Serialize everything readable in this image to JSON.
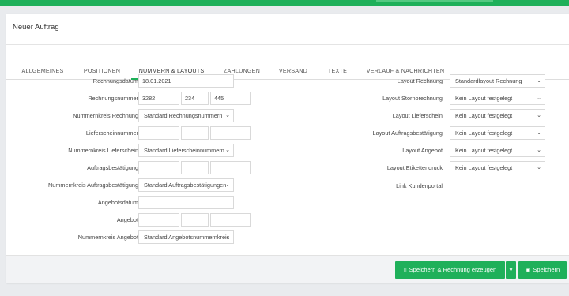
{
  "panel": {
    "title": "Neuer Auftrag"
  },
  "tabs": [
    {
      "label": "ALLGEMEINES"
    },
    {
      "label": "POSITIONEN"
    },
    {
      "label": "NUMMERN & LAYOUTS"
    },
    {
      "label": "ZAHLUNGEN"
    },
    {
      "label": "VERSAND"
    },
    {
      "label": "TEXTE"
    },
    {
      "label": "VERLAUF & NACHRICHTEN"
    }
  ],
  "left": {
    "rechnungsdatum": {
      "label": "Rechnungsdatum",
      "value": "18.01.2021"
    },
    "rechnungsnummer": {
      "label": "Rechnungsnummer",
      "v1": "3282",
      "v2": "234",
      "v3": "445"
    },
    "nk_rechnung": {
      "label": "Nummernkreis Rechnung",
      "value": "Standard Rechnungsnummern"
    },
    "lieferscheinnummer": {
      "label": "Lieferscheinnummer"
    },
    "nk_lieferschein": {
      "label": "Nummernkreis Lieferschein",
      "value": "Standard Lieferscheinnummern"
    },
    "auftragsbestaetigung": {
      "label": "Auftragsbestätigung"
    },
    "nk_auftrag": {
      "label": "Nummernkreis Auftragsbestätigung",
      "value": "Standard Auftragsbestätigungen"
    },
    "angebotsdatum": {
      "label": "Angebotsdatum"
    },
    "angebot": {
      "label": "Angebot"
    },
    "nk_angebot": {
      "label": "Nummernkreis Angebot",
      "value": "Standard Angebotsnummernkreis"
    }
  },
  "right": {
    "layout_rechnung": {
      "label": "Layout Rechnung",
      "value": "Standardlayout Rechnung"
    },
    "layout_storno": {
      "label": "Layout Stornorechnung",
      "value": "Kein Layout festgelegt"
    },
    "layout_lieferschein": {
      "label": "Layout Lieferschein",
      "value": "Kein Layout festgelegt"
    },
    "layout_auftrag": {
      "label": "Layout Auftragsbestätigung",
      "value": "Kein Layout festgelegt"
    },
    "layout_angebot": {
      "label": "Layout Angebot",
      "value": "Kein Layout festgelegt"
    },
    "layout_etikett": {
      "label": "Layout Etikettendruck",
      "value": "Kein Layout festgelegt"
    },
    "link_kundenportal": {
      "label": "Link Kundenportal"
    }
  },
  "footer": {
    "save_invoice_label": "Speichern & Rechnung erzeugen",
    "save_label": "Speichern"
  },
  "colors": {
    "accent": "#1fb05a"
  }
}
